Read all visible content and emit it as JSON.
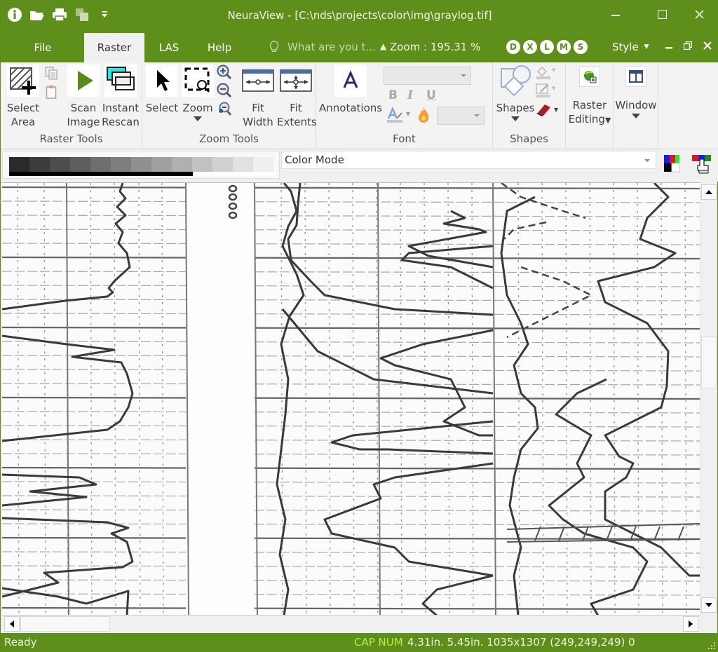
{
  "titlebar": {
    "title": "NeuraView - [C:\\nds\\projects\\color\\img\\graylog.tif]",
    "qat_icons": [
      "info-icon",
      "open-folder-icon",
      "print-icon",
      "save-copy-icon",
      "customize-qat-icon"
    ],
    "window_controls": [
      "minimize",
      "maximize",
      "close"
    ]
  },
  "tabs": [
    {
      "label": "File",
      "active": false
    },
    {
      "label": "Raster",
      "active": true
    },
    {
      "label": "LAS",
      "active": false
    },
    {
      "label": "Help",
      "active": false
    }
  ],
  "tellme": {
    "placeholder": "What are you t..."
  },
  "zoom_readout": "Zoom : 195.31 %",
  "zoom_collapse_glyph": "^",
  "circle_buttons": [
    "D",
    "X",
    "L",
    "M",
    "S"
  ],
  "style_label": "Style",
  "ribbon": {
    "raster_tools": {
      "label": "Raster Tools",
      "select_area": [
        "Select",
        "Area"
      ],
      "scan_image": [
        "Scan",
        "Image"
      ],
      "instant_rescan": [
        "Instant",
        "Rescan"
      ]
    },
    "zoom_tools": {
      "label": "Zoom Tools",
      "select": "Select",
      "zoom": "Zoom",
      "fit_width": [
        "Fit",
        "Width"
      ],
      "fit_extents": [
        "Fit",
        "Extents"
      ]
    },
    "font": {
      "label": "Font",
      "annotations": "Annotations",
      "bold": "B",
      "italic": "I",
      "underline": "U",
      "font_name_value": "",
      "font_size_value": ""
    },
    "shapes": {
      "label": "Shapes",
      "shapes": "Shapes"
    },
    "raster_editing": [
      "Raster",
      "Editing"
    ],
    "window": "Window"
  },
  "color_toolbar": {
    "gray_levels": [
      "#2b2b2b",
      "#3c3c3c",
      "#4d4d4d",
      "#5d5d5d",
      "#6e6e6e",
      "#7e7e7e",
      "#8f8f8f",
      "#a0a0a0",
      "#b0b0b0",
      "#c1c1c1",
      "#d1d1d1",
      "#e1e1e1",
      "#efefef"
    ],
    "threshold_fraction": 0.69,
    "color_mode": "Color Mode"
  },
  "status": {
    "ready": "Ready",
    "caps": "CAP NUM",
    "info": "4.31in. 5.45in. 1035x1307 (249,249,249) 0"
  },
  "colors": {
    "accent": "#5e8f1b",
    "caps_text": "#b9ef3d"
  }
}
